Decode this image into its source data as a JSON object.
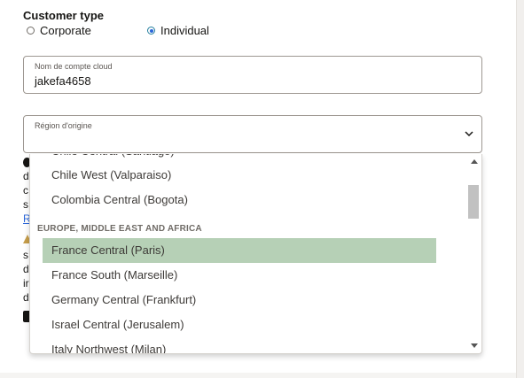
{
  "customer_type": {
    "title": "Customer type",
    "options": [
      {
        "label": "Corporate",
        "checked": false
      },
      {
        "label": "Individual",
        "checked": true
      }
    ]
  },
  "cloud_account": {
    "label": "Nom de compte cloud",
    "value": "jakefa4658"
  },
  "home_region": {
    "label": "Région d'origine",
    "value": "",
    "icon": "chevron-down-icon"
  },
  "behind_text": {
    "line1": "d",
    "line2": "c",
    "line3": "s",
    "link": "R",
    "line4": "s",
    "line5": "d",
    "line6": "ir",
    "line7": "d"
  },
  "dropdown": {
    "partial_top_item": "Chile Central (Santiago)",
    "items_before_group": [
      "Chile West (Valparaiso)",
      "Colombia Central (Bogota)"
    ],
    "group_label": "EUROPE, MIDDLE EAST AND AFRICA",
    "items": [
      {
        "label": "France Central (Paris)",
        "selected": true
      },
      {
        "label": "France South (Marseille)",
        "selected": false
      },
      {
        "label": "Germany Central (Frankfurt)",
        "selected": false
      },
      {
        "label": "Israel Central (Jerusalem)",
        "selected": false
      },
      {
        "label": "Italy Northwest (Milan)",
        "selected": false
      }
    ]
  },
  "colors": {
    "selected_bg": "#b6d0b6",
    "radio_accent": "#2a66d9",
    "border": "#9e9892"
  }
}
